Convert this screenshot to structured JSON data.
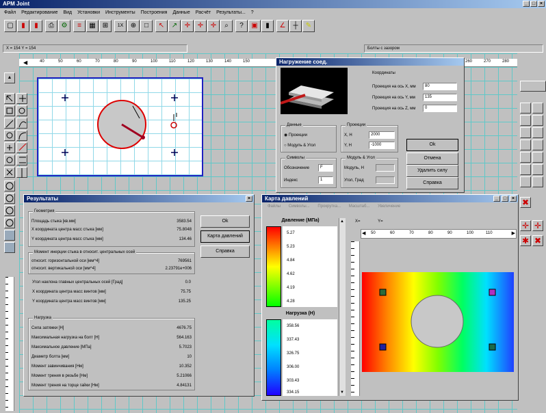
{
  "app": {
    "title": "APM Joint"
  },
  "menu": [
    "Файл",
    "Редактирование",
    "Вид",
    "Установки",
    "Инструменты",
    "Построения",
    "Данные",
    "Расчёт",
    "Результаты...",
    "?"
  ],
  "status": {
    "coords": "X = 154 Y = 154",
    "hint": "Болты с зазором"
  },
  "ruler": {
    "ticks": [
      "40",
      "50",
      "60",
      "70",
      "80",
      "90",
      "100",
      "110",
      "120",
      "130",
      "140",
      "150"
    ],
    "right_ticks": [
      "260",
      "270",
      "280"
    ]
  },
  "loads_dialog": {
    "title": "Нагружение соед.",
    "coords_title": "Координаты",
    "coords": [
      {
        "label": "Проекция на ось X, мм",
        "value": "80"
      },
      {
        "label": "Проекция на ось Y, мм",
        "value": "135"
      },
      {
        "label": "Проекция на ось Z, мм",
        "value": "0"
      }
    ],
    "data_group": "Данные",
    "radio_projections": "Проекции",
    "radio_modulus": "Модуль & Угол",
    "proj_group": "Проекции",
    "proj_x_label": "X, Н",
    "proj_x": "2000",
    "proj_y_label": "Y, Н",
    "proj_y": "-1000",
    "symbols_group": "Символы",
    "designation_label": "Обозначение",
    "designation": "F",
    "index_label": "Индекс",
    "index": "1",
    "modangle_group": "Модуль & Угол",
    "modulus_label": "Модуль, Н",
    "angle_label": "Угол, Град",
    "buttons": {
      "ok": "Ok",
      "cancel": "Отмена",
      "delete": "Удалить силу",
      "help": "Справка"
    }
  },
  "results": {
    "title": "Результаты",
    "geometry_group": "Геометрия",
    "geometry": [
      {
        "label": "Площадь стыка [кв.мм]",
        "value": "3583.54"
      },
      {
        "label": "X координата центра масс стыка [мм]",
        "value": "75.8048"
      },
      {
        "label": "Y координата центра масс стыка [мм]",
        "value": "134.46"
      }
    ],
    "inertia_group": "Момент инерции стыка в относит. центральных осей",
    "inertia": [
      {
        "label": "относит. горизонтальной оси [мм^4]",
        "value": "769561"
      },
      {
        "label": "относит. вертикальной оси [мм^4]",
        "value": "2.23791e+006"
      }
    ],
    "axes": [
      {
        "label": "Угол наклона главных центральных осей [Град]",
        "value": "0.0"
      },
      {
        "label": "X координата центра масс винтов [мм]",
        "value": "75.75"
      },
      {
        "label": "Y координата центра масс винтов [мм]",
        "value": "135.25"
      }
    ],
    "load_group": "Нагрузка",
    "load": [
      {
        "label": "Сила затяжки [Н]",
        "value": "4676.75"
      },
      {
        "label": "Максимальная нагрузка на болт [Н]",
        "value": "564.163"
      },
      {
        "label": "Максимальное давление [МПа]",
        "value": "5.7023"
      },
      {
        "label": "Диаметр болта [мм]",
        "value": "10"
      },
      {
        "label": "Момент завинчивания [Нм]",
        "value": "10.352"
      },
      {
        "label": "Момент трения в резьбе [Нм]",
        "value": "5.21066"
      },
      {
        "label": "Момент трения на торце гайки [Нм]",
        "value": "4.84131"
      }
    ],
    "buttons": {
      "ok": "Ok",
      "pressure_map": "Карта давлений",
      "help": "Справка"
    }
  },
  "pressure_map": {
    "title": "Карта давлений",
    "menu": [
      "Файлы",
      "Символы...",
      "Прокрутка...",
      "Масштаб...",
      "Увеличение"
    ],
    "pressure_header": "Давление (МПа)",
    "pressure_ticks": [
      "5.27",
      "5.23",
      "4.84",
      "4.62",
      "4.19",
      "4.28"
    ],
    "load_header": "Нагрузка (Н)",
    "load_ticks": [
      "358.56",
      "337.43",
      "326.75",
      "306.00",
      "303.43",
      "334.15"
    ],
    "ruler_labels": [
      "X=",
      "Y="
    ],
    "ruler_ticks": [
      "50",
      "60",
      "70",
      "80",
      "90",
      "100",
      "110"
    ]
  },
  "colors": {
    "title_bar": "#0a246a",
    "grid": "#5fc8c8",
    "joint_border": "#0000aa",
    "circle": "#cc0000"
  }
}
